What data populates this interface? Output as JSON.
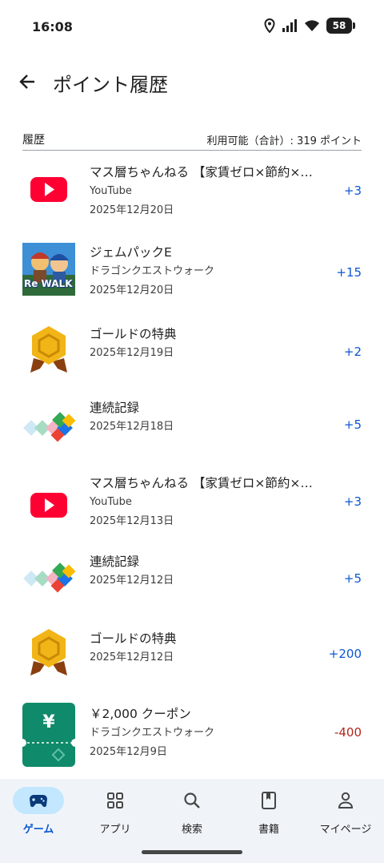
{
  "status_bar": {
    "time": "16:08",
    "battery": "58"
  },
  "app_bar": {
    "title": "ポイント履歴"
  },
  "list_header": {
    "left": "履歴",
    "right": "利用可能（合計）: 319 ポイント"
  },
  "items": [
    {
      "icon": "youtube-icon",
      "title": "マス層ちゃんねる 【家賃ゼロ×節約×投資…",
      "subtitle": "YouTube",
      "date": "2025年12月20日",
      "points": "+3"
    },
    {
      "icon": "game-thumbnail",
      "title": "ジェムパックE",
      "subtitle": "ドラゴンクエストウォーク",
      "date": "2025年12月20日",
      "points": "+15",
      "thumb_text": "Re WALK"
    },
    {
      "icon": "gold-medal-icon",
      "title": "ゴールドの特典",
      "date": "2025年12月19日",
      "points": "+2"
    },
    {
      "icon": "streak-icon",
      "title": "連続記録",
      "date": "2025年12月18日",
      "points": "+5"
    },
    {
      "icon": "youtube-icon",
      "title": "マス層ちゃんねる 【家賃ゼロ×節約×投資…",
      "subtitle": "YouTube",
      "date": "2025年12月13日",
      "points": "+3"
    },
    {
      "icon": "streak-icon",
      "title": "連続記録",
      "date": "2025年12月12日",
      "points": "+5"
    },
    {
      "icon": "gold-medal-icon",
      "title": "ゴールドの特典",
      "date": "2025年12月12日",
      "points": "+200"
    },
    {
      "icon": "coupon-icon",
      "title": "￥2,000 クーポン",
      "subtitle": "ドラゴンクエストウォーク",
      "date": "2025年12月9日",
      "points": "-400",
      "coupon_symbol": "¥"
    }
  ],
  "bottom_nav": [
    {
      "label": "ゲーム",
      "icon": "gamepad-icon",
      "active": true
    },
    {
      "label": "アプリ",
      "icon": "apps-grid-icon",
      "active": false
    },
    {
      "label": "検索",
      "icon": "search-icon",
      "active": false
    },
    {
      "label": "書籍",
      "icon": "book-icon",
      "active": false
    },
    {
      "label": "マイページ",
      "icon": "person-icon",
      "active": false
    }
  ],
  "colors": {
    "accent": "#0b57d0",
    "negative": "#b3261e",
    "nav_active_bg": "#c2e7ff",
    "youtube_red": "#ff0033"
  }
}
